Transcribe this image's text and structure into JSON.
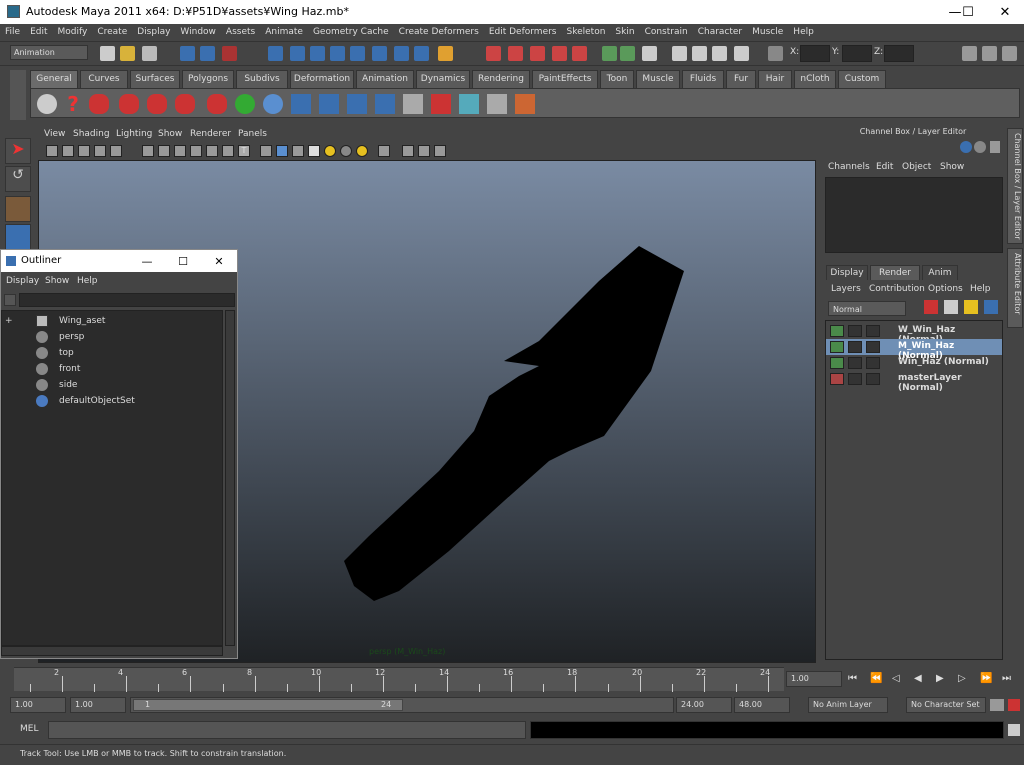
{
  "window": {
    "title": "Autodesk Maya 2011 x64: D:¥P51D¥assets¥Wing Haz.mb*",
    "minimize": "—",
    "maximize": "☐",
    "close": "✕"
  },
  "menu": [
    "File",
    "Edit",
    "Modify",
    "Create",
    "Display",
    "Window",
    "Assets",
    "Animate",
    "Geometry Cache",
    "Create Deformers",
    "Edit Deformers",
    "Skeleton",
    "Skin",
    "Constrain",
    "Character",
    "Muscle",
    "Help"
  ],
  "statusline": {
    "mode": "Animation",
    "x_label": "X:",
    "y_label": "Y:",
    "z_label": "Z:"
  },
  "shelf_tabs": [
    "General",
    "Curves",
    "Surfaces",
    "Polygons",
    "Subdivs",
    "Deformation",
    "Animation",
    "Dynamics",
    "Rendering",
    "PaintEffects",
    "Toon",
    "Muscle",
    "Fluids",
    "Fur",
    "Hair",
    "nCloth",
    "Custom"
  ],
  "viewport": {
    "menu": [
      "View",
      "Shading",
      "Lighting",
      "Show",
      "Renderer",
      "Panels"
    ],
    "camera_label": "persp (M_Win_Haz)"
  },
  "outliner": {
    "title": "Outliner",
    "menu": [
      "Display",
      "Show",
      "Help"
    ],
    "items": [
      {
        "label": "Wing_aset",
        "icon": "group-icon",
        "expand": "+"
      },
      {
        "label": "persp",
        "icon": "camera-icon"
      },
      {
        "label": "top",
        "icon": "camera-icon"
      },
      {
        "label": "front",
        "icon": "camera-icon"
      },
      {
        "label": "side",
        "icon": "camera-icon"
      },
      {
        "label": "defaultObjectSet",
        "icon": "set-icon"
      }
    ]
  },
  "channel_box": {
    "header": "Channel Box / Layer Editor",
    "menu": [
      "Channels",
      "Edit",
      "Object",
      "Show"
    ],
    "tabs": [
      "Display",
      "Render",
      "Anim"
    ],
    "active_tab": "Render",
    "layer_menu": [
      "Layers",
      "Contribution",
      "Options",
      "Help"
    ],
    "blend_mode": "Normal",
    "layers": [
      {
        "name": "W_Win_Haz (Normal)",
        "selected": false
      },
      {
        "name": "M_Win_Haz (Normal)",
        "selected": true
      },
      {
        "name": "Win_Haz (Normal)",
        "selected": false
      },
      {
        "name": "masterLayer (Normal)",
        "selected": false
      }
    ]
  },
  "side_tabs": [
    "Channel Box / Layer Editor",
    "Attribute Editor"
  ],
  "timeline": {
    "ticks": [
      "2",
      "4",
      "6",
      "8",
      "10",
      "12",
      "14",
      "16",
      "18",
      "20",
      "22",
      "24"
    ],
    "current_frame": "1.00"
  },
  "range": {
    "start": "1.00",
    "playback_start": "1.00",
    "slider_start": "1",
    "slider_end": "24",
    "playback_end": "24.00",
    "end": "48.00",
    "anim_layer": "No Anim Layer",
    "character_set": "No Character Set"
  },
  "mel": {
    "label": "MEL"
  },
  "help_line": "Track Tool: Use LMB or MMB to track. Shift to constrain translation.",
  "colors": {
    "selection": "#6f8fb5",
    "panel": "#444444",
    "field": "#2b2b2b"
  }
}
